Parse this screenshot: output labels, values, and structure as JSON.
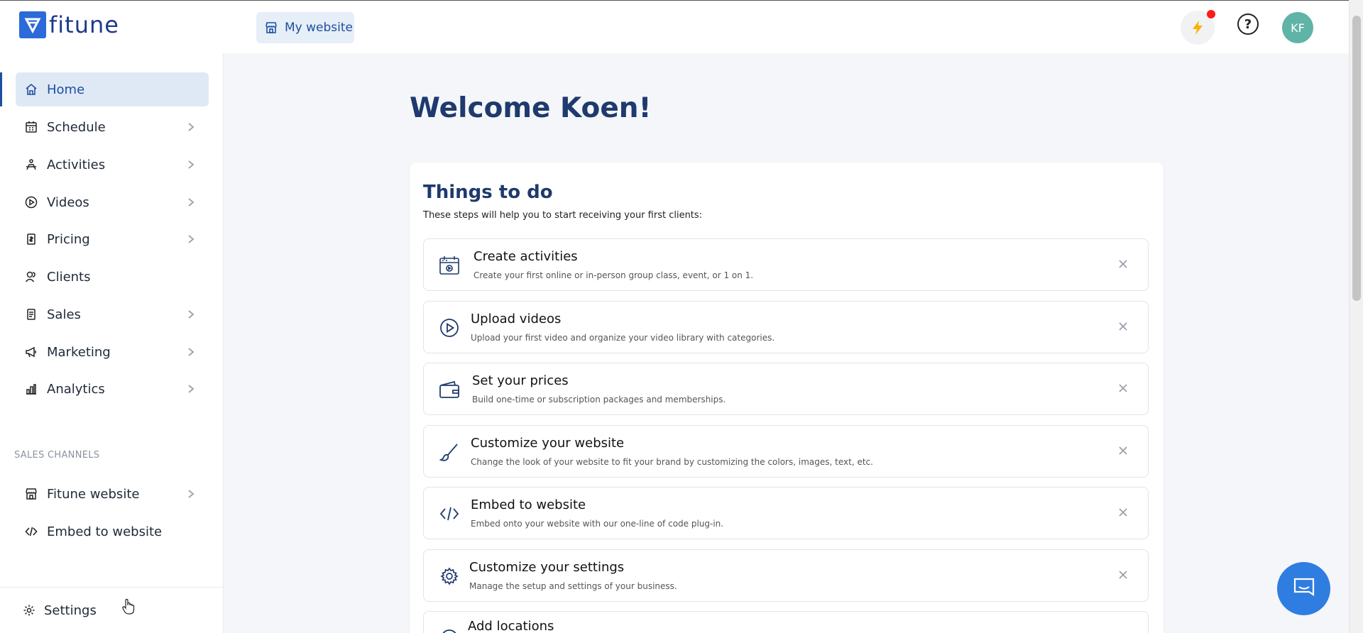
{
  "app": {
    "logo_text": "fitune"
  },
  "header": {
    "site_button": "My website",
    "avatar_initials": "KF"
  },
  "sidebar": {
    "items": [
      {
        "label": "Home",
        "icon": "home-icon",
        "active": true
      },
      {
        "label": "Schedule",
        "icon": "calendar-icon"
      },
      {
        "label": "Activities",
        "icon": "activity-icon"
      },
      {
        "label": "Videos",
        "icon": "play-icon"
      },
      {
        "label": "Pricing",
        "icon": "price-tag-icon"
      },
      {
        "label": "Clients",
        "icon": "clients-icon"
      },
      {
        "label": "Sales",
        "icon": "receipt-icon"
      },
      {
        "label": "Marketing",
        "icon": "megaphone-icon"
      },
      {
        "label": "Analytics",
        "icon": "bar-chart-icon"
      }
    ],
    "section_label": "SALES CHANNELS",
    "channels": [
      {
        "label": "Fitune website",
        "icon": "store-icon"
      },
      {
        "label": "Embed to website",
        "icon": "code-icon"
      }
    ],
    "settings_label": "Settings"
  },
  "main": {
    "welcome": "Welcome Koen!",
    "todo": {
      "title": "Things to do",
      "subtitle": "These steps will help you to start receiving your first clients:",
      "tasks": [
        {
          "title": "Create activities",
          "desc": "Create your first online or in-person group class, event, or 1 on 1.",
          "icon": "calendar-activity-icon"
        },
        {
          "title": "Upload videos",
          "desc": "Upload your first video and organize your video library with categories.",
          "icon": "play-circle-icon"
        },
        {
          "title": "Set your prices",
          "desc": "Build one-time or subscription packages and memberships.",
          "icon": "wallet-icon"
        },
        {
          "title": "Customize your website",
          "desc": "Change the look of your website to fit your brand by customizing the colors, images, text, etc.",
          "icon": "brush-icon"
        },
        {
          "title": "Embed to website",
          "desc": "Embed onto your website with our one-line of code plug-in.",
          "icon": "code-icon"
        },
        {
          "title": "Customize your settings",
          "desc": "Manage the setup and settings of your business.",
          "icon": "gear-icon"
        },
        {
          "title": "Add locations",
          "desc": "",
          "icon": "location-icon"
        }
      ]
    }
  },
  "colors": {
    "primary": "#1e4fa0",
    "heading": "#1e3a6e",
    "accent": "#2f7de1",
    "avatar": "#5fb3a7",
    "notification": "#ff1a1a"
  }
}
